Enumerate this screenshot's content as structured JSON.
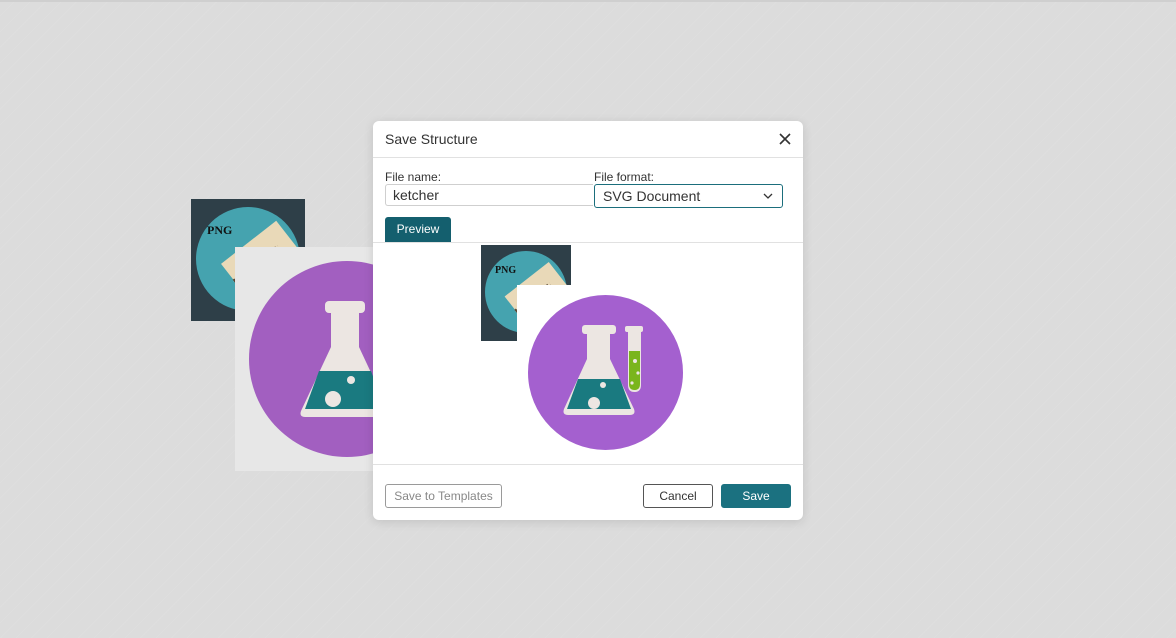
{
  "dialog": {
    "title": "Save Structure",
    "file_name_label": "File name:",
    "file_name_value": "ketcher",
    "file_format_label": "File format:",
    "file_format_selected": "SVG Document",
    "preview_tab": "Preview",
    "buttons": {
      "save_to_templates": "Save to Templates",
      "cancel": "Cancel",
      "save": "Save"
    }
  },
  "images": {
    "png_badge_text": "PNG"
  },
  "colors": {
    "accent": "#1b7180",
    "preview_tab": "#145f6e",
    "purple_circle": "#a460cf",
    "teal_circle": "#45a3af",
    "flask_liquid": "#1a7a80",
    "test_tube_liquid": "#7ab51d"
  },
  "icons": [
    "close-icon",
    "chevron-down-icon",
    "flask-icon",
    "test-tube-icon",
    "png-stamp-icon"
  ]
}
